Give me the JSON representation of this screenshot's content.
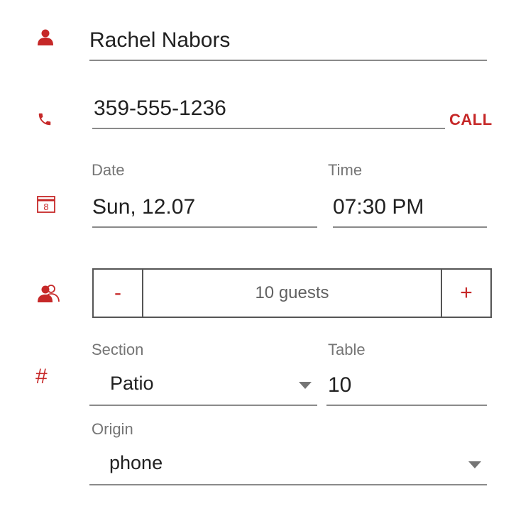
{
  "colors": {
    "accent": "#c62828",
    "text": "#212121",
    "label": "#757575",
    "underline": "#8a8a8a"
  },
  "icons": {
    "name": "person-icon",
    "phone": "phone-icon",
    "date": "calendar-icon",
    "guests": "people-icon",
    "section": "hash-icon",
    "caret": "caret-down-icon"
  },
  "name_field": {
    "value": "Rachel Nabors"
  },
  "phone_field": {
    "value": "359-555-1236",
    "call_label": "CALL"
  },
  "calendar_icon": {
    "day": "8"
  },
  "date_field": {
    "label": "Date",
    "value": "Sun, 12.07"
  },
  "time_field": {
    "label": "Time",
    "value": "07:30 PM"
  },
  "guests": {
    "minus_label": "-",
    "value_text": "10 guests",
    "plus_label": "+"
  },
  "section_field": {
    "label": "Section",
    "value": "Patio"
  },
  "table_field": {
    "label": "Table",
    "value": "10"
  },
  "section_icon": {
    "glyph": "#"
  },
  "origin_field": {
    "label": "Origin",
    "value": "phone"
  }
}
